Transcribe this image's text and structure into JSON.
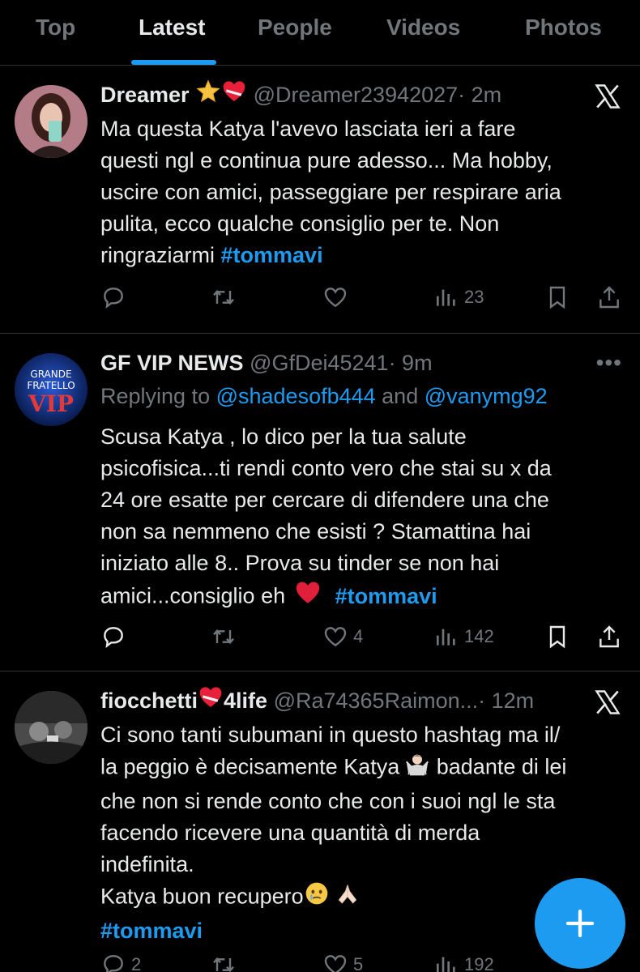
{
  "tabs": [
    {
      "label": "Top"
    },
    {
      "label": "Latest",
      "active": true
    },
    {
      "label": "People"
    },
    {
      "label": "Videos"
    },
    {
      "label": "Photos"
    }
  ],
  "tweets": [
    {
      "name": "Dreamer",
      "handle": "@Dreamer23942027",
      "time": "· 2m",
      "lines": [
        "Ma questa Katya l'avevo lasciata ieri a fare",
        "questi ngl e continua pure adesso... Ma hobby,",
        "uscire con amici, passeggiare per respirare aria",
        "pulita, ecco qualche consiglio per te. Non",
        "ringraziarmi "
      ],
      "hashtag": "#tommavi",
      "replies": "",
      "retweets": "",
      "likes": "",
      "views": "23"
    },
    {
      "name": "GF VIP NEWS",
      "handle": "@GfDei45241",
      "time": "· 9m",
      "replying_prefix": "Replying to ",
      "reply_to_1": "@shadesofb444",
      "reply_and": " and ",
      "reply_to_2": "@vanymg92",
      "lines": [
        "Scusa Katya , lo dico per la tua salute",
        "psicofisica...ti rendi conto vero che stai su x da",
        "24 ore esatte per cercare di difendere una che",
        "non sa nemmeno che esisti ? Stamattina hai",
        "iniziato alle 8.. Prova su tinder se non hai",
        "amici...consiglio eh "
      ],
      "hashtag": "#tommavi",
      "replies": "",
      "retweets": "",
      "likes": "4",
      "views": "142"
    },
    {
      "name_part1": "fiocchetti",
      "name_part2": "4life",
      "handle": "@Ra74365Raimon...",
      "time": "· 12m",
      "lines": [
        "Ci sono tanti subumani in questo hashtag ma il/",
        "la peggio è decisamente Katya",
        "che non si rende conto che con i suoi ngl le sta",
        "facendo ricevere una quantità di merda",
        "indefinita.",
        "Katya buon recupero"
      ],
      "line2_suffix": " badante di lei",
      "hashtag": "#tommavi",
      "replies": "2",
      "retweets": "",
      "likes": "5",
      "views": "192"
    }
  ],
  "icons": {
    "reply": "reply-icon",
    "retweet": "retweet-icon",
    "like": "heart-icon",
    "views": "views-icon",
    "bookmark": "bookmark-icon",
    "share": "share-icon",
    "x": "x-logo-icon",
    "more": "more-icon",
    "compose": "plus-icon"
  },
  "colors": {
    "accent": "#1d9bf0",
    "muted": "#71767b",
    "text": "#e7e9ea",
    "background": "#000000",
    "heart": "#e0245e"
  }
}
